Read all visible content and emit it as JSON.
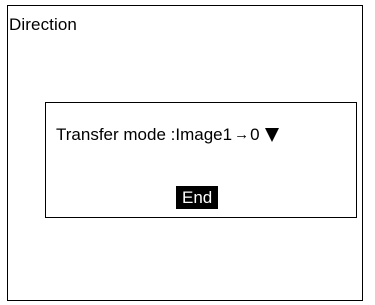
{
  "panel": {
    "title": "Direction"
  },
  "dialog": {
    "setting_label": "Transfer mode : ",
    "setting_value_source": "Image1",
    "setting_value_arrow": "→",
    "setting_value_target": "0",
    "dropdown_icon": "triangle-down-icon",
    "end_label": "End"
  },
  "colors": {
    "background": "#ffffff",
    "border": "#000000",
    "button_background": "#000000",
    "button_text": "#ffffff"
  }
}
